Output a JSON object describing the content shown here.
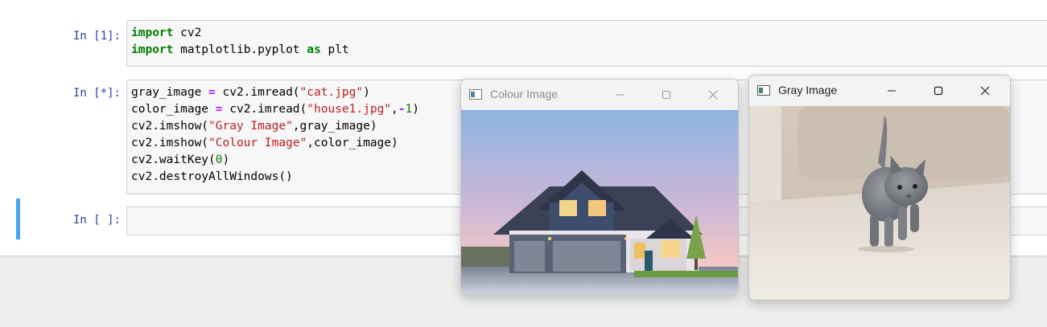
{
  "cells": [
    {
      "prompt": "In [1]:",
      "lines": [
        [
          {
            "t": "import",
            "c": "kw"
          },
          {
            "t": " cv2",
            "c": ""
          }
        ],
        [
          {
            "t": "import",
            "c": "kw"
          },
          {
            "t": " matplotlib.pyplot ",
            "c": ""
          },
          {
            "t": "as",
            "c": "kw"
          },
          {
            "t": " plt",
            "c": ""
          }
        ]
      ]
    },
    {
      "prompt": "In [*]:",
      "lines": [
        [
          {
            "t": "gray_image ",
            "c": ""
          },
          {
            "t": "=",
            "c": "op"
          },
          {
            "t": " cv2.imread(",
            "c": ""
          },
          {
            "t": "\"cat.jpg\"",
            "c": "str"
          },
          {
            "t": ")",
            "c": ""
          }
        ],
        [
          {
            "t": "color_image ",
            "c": ""
          },
          {
            "t": "=",
            "c": "op"
          },
          {
            "t": " cv2.imread(",
            "c": ""
          },
          {
            "t": "\"house1.jpg\"",
            "c": "str"
          },
          {
            "t": ",",
            "c": ""
          },
          {
            "t": "-",
            "c": "op"
          },
          {
            "t": "1",
            "c": "num"
          },
          {
            "t": ")",
            "c": ""
          }
        ],
        [
          {
            "t": "cv2.imshow(",
            "c": ""
          },
          {
            "t": "\"Gray Image\"",
            "c": "str"
          },
          {
            "t": ",gray_image)",
            "c": ""
          }
        ],
        [
          {
            "t": "cv2.imshow(",
            "c": ""
          },
          {
            "t": "\"Colour Image\"",
            "c": "str"
          },
          {
            "t": ",color_image)",
            "c": ""
          }
        ],
        [
          {
            "t": "cv2.waitKey(",
            "c": ""
          },
          {
            "t": "0",
            "c": "num"
          },
          {
            "t": ")",
            "c": ""
          }
        ],
        [
          {
            "t": "cv2.destroyAllWindows()",
            "c": ""
          }
        ]
      ]
    },
    {
      "prompt": "In [ ]:",
      "lines": []
    }
  ],
  "windows": {
    "colour": {
      "title": "Colour Image",
      "image": "house photo"
    },
    "gray": {
      "title": "Gray Image",
      "image": "kitten photo"
    }
  },
  "icons": {
    "minimize": "minimize-icon",
    "maximize": "maximize-icon",
    "close": "close-icon",
    "app": "opencv-window-icon"
  }
}
